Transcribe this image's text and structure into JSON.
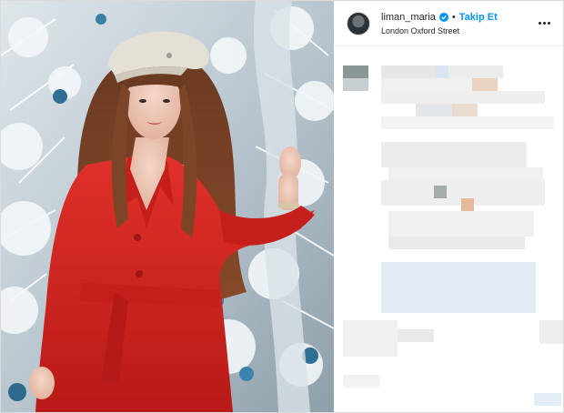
{
  "post": {
    "author": {
      "username": "liman_maria",
      "verified": true,
      "follow_label": "Takip Et",
      "separator": "•",
      "location": "London Oxford Street"
    },
    "more_icon": "more-horizontal-icon",
    "verified_icon": "verified-badge-icon"
  },
  "colors": {
    "accent": "#0095f6",
    "text": "#262626",
    "coat": "#d8221f"
  }
}
